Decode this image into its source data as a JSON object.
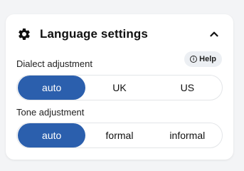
{
  "panel": {
    "title": "Language settings",
    "icon": "gear-icon",
    "collapse_icon": "chevron-up-icon"
  },
  "help": {
    "label": "Help",
    "icon_glyph": "i"
  },
  "dialect": {
    "label": "Dialect adjustment",
    "options": [
      "auto",
      "UK",
      "US"
    ],
    "selected": "auto"
  },
  "tone": {
    "label": "Tone adjustment",
    "options": [
      "auto",
      "formal",
      "informal"
    ],
    "selected": "auto"
  },
  "colors": {
    "accent": "#2b5fad"
  }
}
